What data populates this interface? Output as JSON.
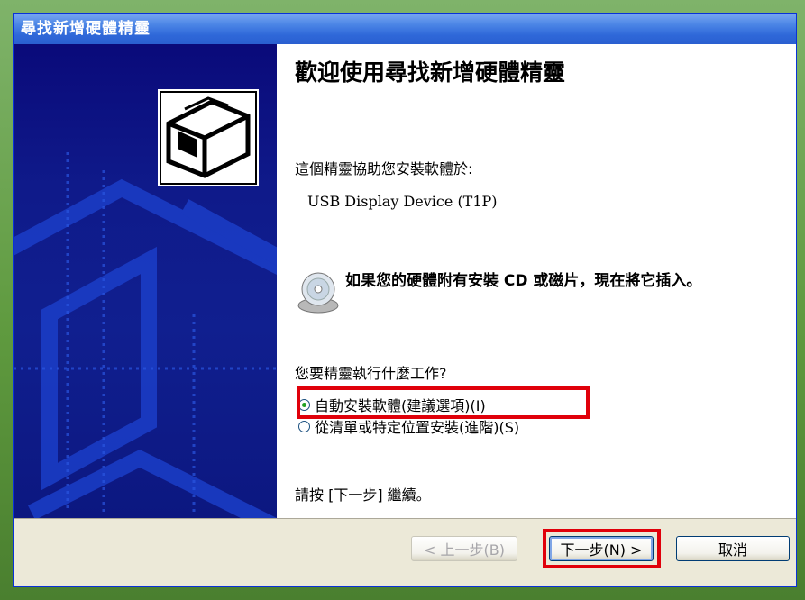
{
  "window": {
    "title": "尋找新增硬體精靈"
  },
  "wizard": {
    "heading": "歡迎使用尋找新增硬體精靈",
    "intro": "這個精靈協助您安裝軟體於:",
    "device_name": "USB Display Device (T1P)",
    "cd_prompt": "如果您的硬體附有安裝 CD 或磁片，現在將它插入。",
    "question": "您要精靈執行什麼工作?",
    "options": [
      {
        "label": "自動安裝軟體(建議選項)(I)",
        "selected": true
      },
      {
        "label": "從清單或特定位置安裝(進階)(S)",
        "selected": false
      }
    ],
    "continue_hint": "請按 [下一步] 繼續。"
  },
  "buttons": {
    "back_label": "< 上一步(B)",
    "next_label": "下一步(N) >",
    "cancel_label": "取消"
  },
  "colors": {
    "title_bar": "#2f68d9",
    "left_panel": "#0f1a8a",
    "highlight": "#e0000a",
    "dialog_face": "#ece9d8"
  },
  "icons": [
    "hardware-device-icon",
    "cd-disk-icon"
  ]
}
